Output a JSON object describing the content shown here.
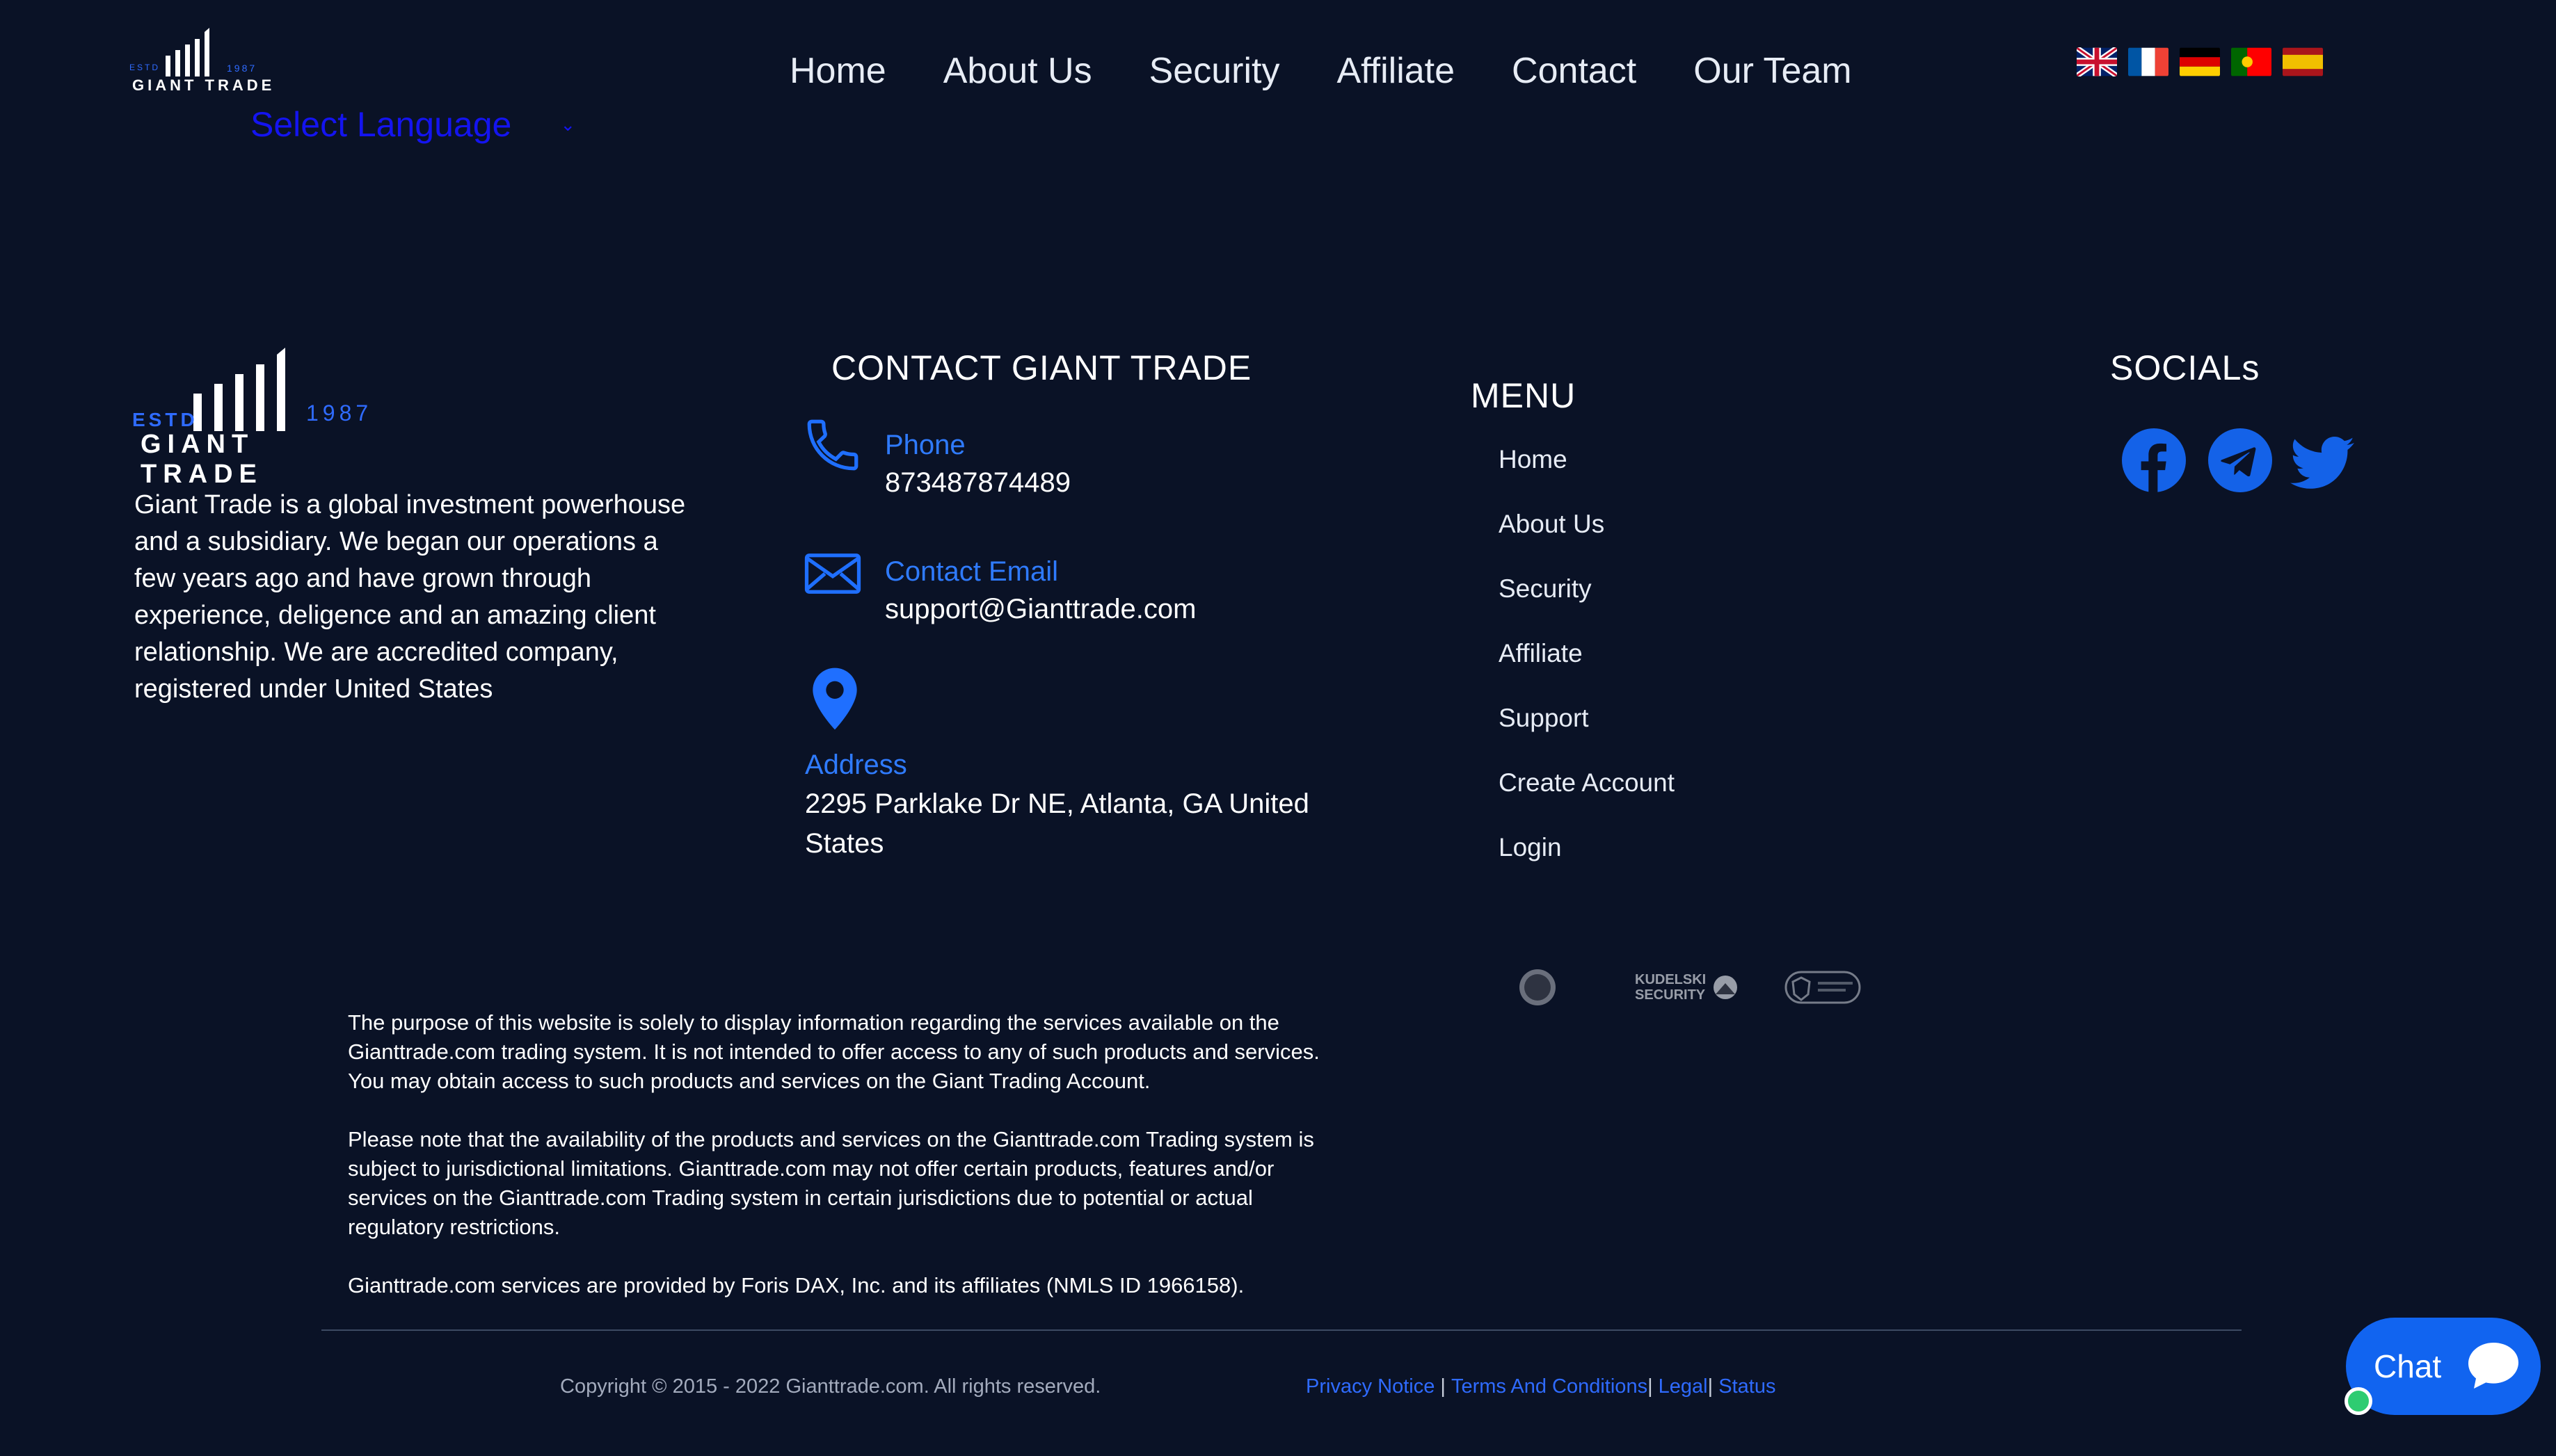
{
  "header": {
    "logo": {
      "estd": "ESTD",
      "year": "1987",
      "name": "GIANT TRADE"
    },
    "select_language": "Select Language",
    "nav": [
      "Home",
      "About Us",
      "Security",
      "Affiliate",
      "Contact",
      "Our Team"
    ],
    "flags": [
      "uk-flag-icon",
      "france-flag-icon",
      "germany-flag-icon",
      "portugal-flag-icon",
      "spain-flag-icon"
    ]
  },
  "about": {
    "logo": {
      "estd": "ESTD",
      "year": "1987",
      "name": "GIANT TRADE"
    },
    "lines": [
      "Giant Trade is a global investment powerhouse",
      "and a subsidiary. We began our operations a",
      "few years ago and have grown through",
      "experience, deligence and an amazing client",
      "relationship. We are accredited company,",
      "registered under United States"
    ]
  },
  "contact": {
    "title": "CONTACT GIANT TRADE",
    "phone_label": "Phone",
    "phone_value": "873487874489",
    "email_label": "Contact Email",
    "email_value": "support@Gianttrade.com",
    "address_label": "Address",
    "address_line1": "2295 Parklake Dr NE, Atlanta, GA United",
    "address_line2": "States"
  },
  "menu": {
    "title": "MENU",
    "items": [
      "Home",
      "About Us",
      "Security",
      "Affiliate",
      "Support",
      "Create Account",
      "Login"
    ]
  },
  "socials": {
    "title": "SOCIALs",
    "items": [
      "facebook-icon",
      "telegram-icon",
      "twitter-icon"
    ]
  },
  "badges": {
    "kudelski_line1": "KUDELSKI",
    "kudelski_line2": "SECURITY"
  },
  "disclaimer": {
    "p1_lines": [
      "The purpose of this website is solely to display information regarding the services available on the",
      "Gianttrade.com trading system. It is not intended to offer access to any of such products and services.",
      "You may obtain access to such products and services on the Giant Trading Account."
    ],
    "p2_lines": [
      "Please note that the availability of the products and services on the Gianttrade.com Trading system is",
      "subject to jurisdictional limitations. Gianttrade.com may not offer certain products, features and/or",
      "services on the Gianttrade.com Trading system in certain jurisdictions due to potential or actual",
      "regulatory restrictions."
    ],
    "p3_lines": [
      "Gianttrade.com services are provided by Foris DAX, Inc. and its affiliates (NMLS ID 1966158)."
    ]
  },
  "footer": {
    "copyright": "Copyright © 2015 - 2022 Gianttrade.com. All rights reserved.",
    "privacy": "Privacy Notice",
    "sep1": " | ",
    "terms": "Terms And Conditions",
    "sep2": "| ",
    "legal": "Legal",
    "sep3": "| ",
    "status": "Status"
  },
  "chat": {
    "label": "Chat"
  },
  "colors": {
    "background": "#0a1226",
    "accent": "#2f6bff",
    "chat": "#1164f0",
    "select_language": "#1414f0"
  }
}
